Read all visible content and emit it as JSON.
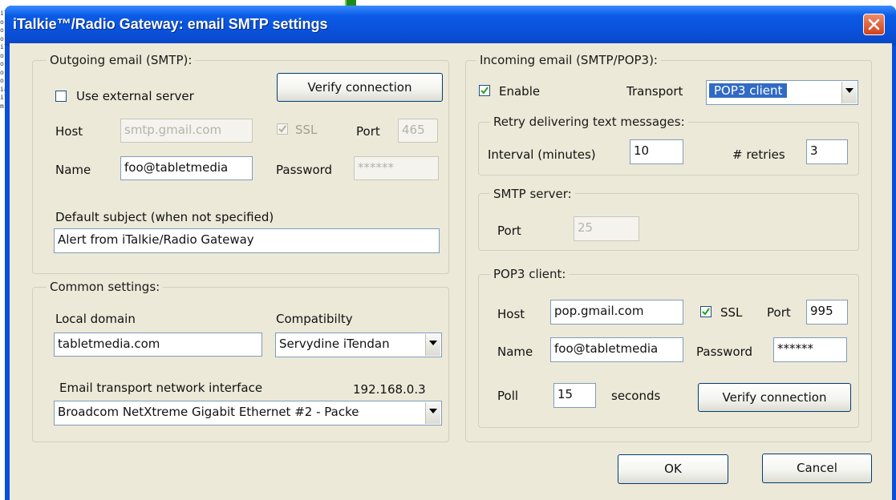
{
  "window": {
    "title": "iTalkie™/Radio Gateway: email SMTP settings"
  },
  "background": {
    "fragments": [
      "il",
      "o:",
      "o:",
      "o:",
      "il",
      "o:",
      "o:",
      "o:",
      "o:",
      "ia",
      "il",
      "m"
    ]
  },
  "outgoing": {
    "legend": "Outgoing email (SMTP):",
    "use_external_label": "Use external server",
    "use_external_checked": false,
    "verify_label": "Verify connection",
    "host_label": "Host",
    "host_value": "smtp.gmail.com",
    "ssl_label": "SSL",
    "ssl_checked": true,
    "port_label": "Port",
    "port_value": "465",
    "name_label": "Name",
    "name_value": "foo@tabletmedia",
    "password_label": "Password",
    "password_value": "******",
    "subject_label": "Default subject (when not specified)",
    "subject_value": "Alert from iTalkie/Radio Gateway"
  },
  "common": {
    "legend": "Common settings:",
    "local_domain_label": "Local domain",
    "local_domain_value": "tabletmedia.com",
    "compat_label": "Compatibilty",
    "compat_value": "Servydine iTendan",
    "iface_label": "Email transport network interface",
    "iface_ip": "192.168.0.3",
    "iface_value": "Broadcom NetXtreme Gigabit Ethernet #2 - Packe"
  },
  "incoming": {
    "legend": "Incoming email (SMTP/POP3):",
    "enable_label": "Enable",
    "enable_checked": true,
    "transport_label": "Transport",
    "transport_value": "POP3 client",
    "retry": {
      "legend": "Retry delivering text messages:",
      "interval_label": "Interval (minutes)",
      "interval_value": "10",
      "retries_label": "# retries",
      "retries_value": "3"
    },
    "smtp_server": {
      "legend": "SMTP server:",
      "port_label": "Port",
      "port_value": "25"
    },
    "pop3": {
      "legend": "POP3 client:",
      "host_label": "Host",
      "host_value": "pop.gmail.com",
      "ssl_label": "SSL",
      "ssl_checked": true,
      "port_label": "Port",
      "port_value": "995",
      "name_label": "Name",
      "name_value": "foo@tabletmedia",
      "password_label": "Password",
      "password_value": "******",
      "poll_label": "Poll",
      "poll_value": "15",
      "seconds_label": "seconds",
      "verify_label": "Verify connection"
    }
  },
  "footer": {
    "ok_label": "OK",
    "cancel_label": "Cancel"
  },
  "icons": {
    "close": "close-icon",
    "check": "checkmark-icon",
    "dropdown": "chevron-down-icon"
  },
  "colors": {
    "titlebar": "#0a4fd8",
    "dialog_bg": "#ece9d8",
    "selection": "#316ac5",
    "close_button": "#d0431a"
  }
}
